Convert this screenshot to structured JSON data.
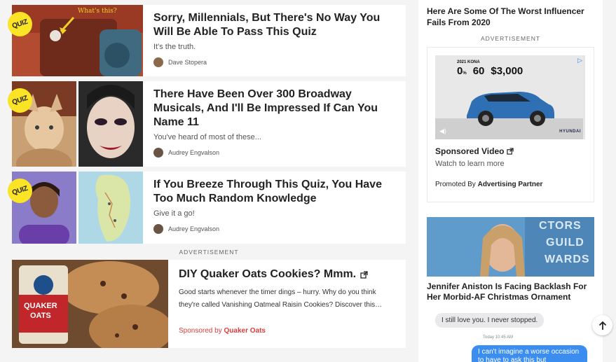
{
  "feed": {
    "cards": [
      {
        "badge": "QUIZ",
        "thumb_caption": "What's this?",
        "title": "Sorry, Millennials, But There's No Way You Will Be Able To Pass This Quiz",
        "desc": "It's the truth.",
        "author": "Dave Stopera"
      },
      {
        "badge": "QUIZ",
        "title": "There Have Been Over 300 Broadway Musicals, And I'll Be Impressed If Can You Name 11",
        "desc": "You've heard of most of these...",
        "author": "Audrey Engvalson"
      },
      {
        "badge": "QUIZ",
        "title": "If You Breeze Through This Quiz, You Have Too Much Random Knowledge",
        "desc": "Give it a go!",
        "author": "Audrey Engvalson"
      }
    ],
    "ad_label": "ADVERTISEMENT",
    "sponsored": {
      "oats_brand_line1": "QUAKER",
      "oats_brand_line2": "OATS",
      "title": "DIY Quaker Oats Cookies? Mmm.",
      "copy": "Good starts whenever the timer dings – hurry. Why do you think they're called Vanishing Oatmeal Raisin Cookies? Discover this…",
      "by_prefix": "Sponsored by",
      "by_brand": "Quaker Oats"
    }
  },
  "rail": {
    "top_story": "Here Are Some Of The Worst Influencer Fails From 2020",
    "ad_label": "ADVERTISEMENT",
    "ad": {
      "model": "2021 KONA",
      "apr": "0",
      "months": "60",
      "cash": "$3,000",
      "brand": "HYUNDAI",
      "sponsored_video": "Sponsored Video",
      "watch": "Watch to learn more",
      "promoted_prefix": "Promoted By",
      "promoted_by": "Advertising Partner"
    },
    "story": {
      "photo_text_1": "CTORS",
      "photo_text_2": "GUILD",
      "photo_text_3": "WARDS",
      "title": "Jennifer Aniston Is Facing Backlash For Her Morbid-AF Christmas Ornament"
    },
    "messages": {
      "incoming": "I still love you. I never stopped.",
      "time": "Today 10:45 AM",
      "outgoing": "I can't imagine a worse occasion to have to ask this but"
    }
  },
  "colors": {
    "quiz_badge": "#fbe326",
    "sponsor_red": "#e03b3b",
    "imessage_blue": "#3b8ef0"
  }
}
